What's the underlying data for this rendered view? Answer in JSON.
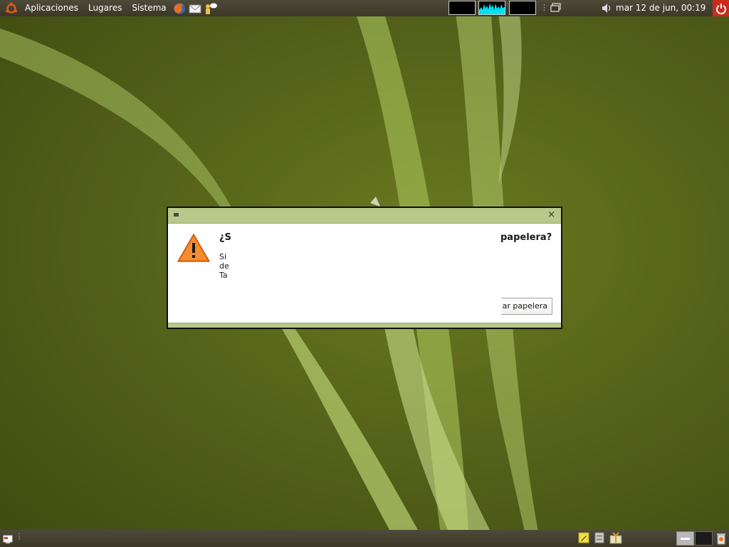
{
  "top_panel": {
    "menus": [
      {
        "label": "Aplicaciones"
      },
      {
        "label": "Lugares"
      },
      {
        "label": "Sistema"
      }
    ],
    "launchers": [
      "firefox-icon",
      "mail-icon",
      "messenger-icon"
    ],
    "clock": "mar 12 de jun, 00:19"
  },
  "dialog": {
    "heading_start": "¿S",
    "heading_end": "papelera?",
    "body_fragments": [
      "Si",
      "de",
      "Ta"
    ],
    "button_label": "ar papelera"
  },
  "colors": {
    "panel": "#3b3828",
    "dialog_frame": "#b8c88a",
    "monitor_cpu": "#00e0f0",
    "logout": "#cc2a1a"
  }
}
